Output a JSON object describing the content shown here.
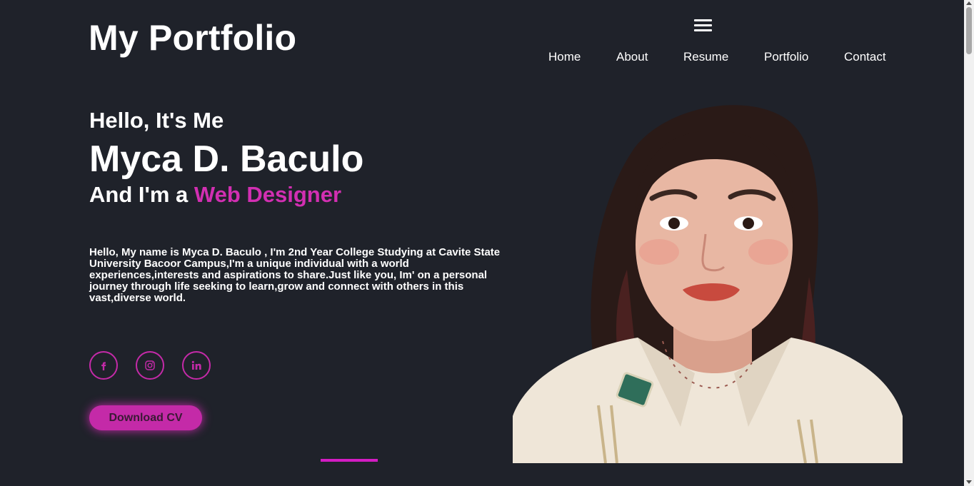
{
  "header": {
    "logo": "My Portfolio",
    "menu_icon": "hamburger-menu-icon",
    "nav": [
      "Home",
      "About",
      "Resume",
      "Portfolio",
      "Contact"
    ]
  },
  "hero": {
    "greeting": "Hello, It's Me",
    "name": "Myca D. Baculo",
    "role_prefix": "And I'm a ",
    "role_accent": "Web Designer",
    "bio": "Hello, My name is Myca D. Baculo , I'm 2nd Year College Studying at Cavite State University Bacoor Campus,I'm a unique individual with a world experiences,interests and aspirations to share.Just like you, Im' on a personal journey through life seeking to learn,grow and connect with others in this vast,diverse world.",
    "socials": [
      "facebook-icon",
      "instagram-icon",
      "linkedin-icon"
    ],
    "cta": "Download CV"
  },
  "colors": {
    "background": "#1f222a",
    "accent": "#c42aa8",
    "text": "#ffffff"
  }
}
